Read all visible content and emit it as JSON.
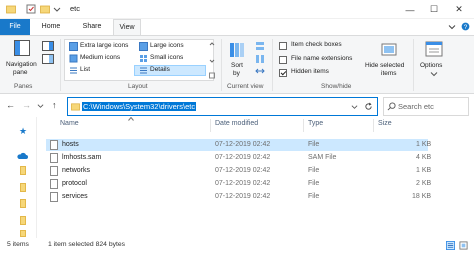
{
  "window": {
    "title": "etc",
    "minimize": "—",
    "maximize": "☐",
    "close": "✕"
  },
  "tabs": {
    "file": "File",
    "home": "Home",
    "share": "Share",
    "view": "View"
  },
  "ribbon": {
    "panes": {
      "navigation_pane": "Navigation",
      "navigation_pane_2": "pane",
      "group": "Panes"
    },
    "layout": {
      "extra_large": "Extra large icons",
      "large": "Large icons",
      "medium": "Medium icons",
      "small": "Small icons",
      "list": "List",
      "details": "Details",
      "group": "Layout"
    },
    "current_view": {
      "sort_by": "Sort",
      "sort_by_2": "by",
      "group": "Current view"
    },
    "show_hide": {
      "item_check_boxes": "Item check boxes",
      "file_name_extensions": "File name extensions",
      "hidden_items": "Hidden items",
      "hide_selected": "Hide selected",
      "hide_selected_2": "items",
      "group": "Show/hide"
    },
    "options": {
      "label": "Options"
    }
  },
  "address": {
    "path": "C:\\Windows\\System32\\drivers\\etc",
    "search_placeholder": "Search etc"
  },
  "columns": {
    "name": "Name",
    "date": "Date modified",
    "type": "Type",
    "size": "Size"
  },
  "files": [
    {
      "name": "hosts",
      "date": "07-12-2019 02:42",
      "type": "File",
      "size": "1 KB"
    },
    {
      "name": "lmhosts.sam",
      "date": "07-12-2019 02:42",
      "type": "SAM File",
      "size": "4 KB"
    },
    {
      "name": "networks",
      "date": "07-12-2019 02:42",
      "type": "File",
      "size": "1 KB"
    },
    {
      "name": "protocol",
      "date": "07-12-2019 02:42",
      "type": "File",
      "size": "2 KB"
    },
    {
      "name": "services",
      "date": "07-12-2019 02:42",
      "type": "File",
      "size": "18 KB"
    }
  ],
  "status": {
    "count": "5 items",
    "selection": "1 item selected  824 bytes"
  },
  "colors": {
    "accent": "#0078d7",
    "file_tab": "#1979ca",
    "selection": "#cce8ff"
  }
}
